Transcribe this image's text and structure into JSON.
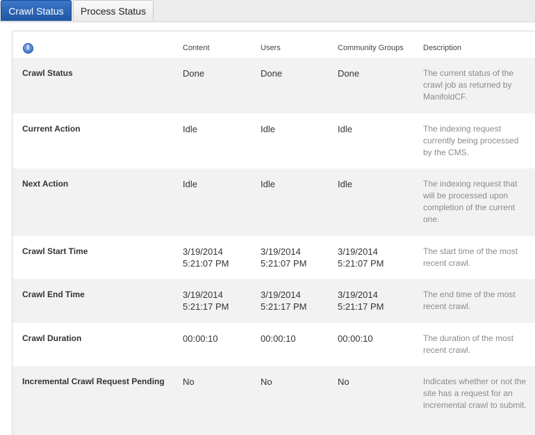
{
  "tabs": {
    "crawl_status": "Crawl Status",
    "process_status": "Process Status"
  },
  "table": {
    "headers": {
      "content": "Content",
      "users": "Users",
      "groups": "Community Groups",
      "description": "Description"
    },
    "rows": [
      {
        "label": "Crawl Status",
        "content": "Done",
        "users": "Done",
        "groups": "Done",
        "description": "The current status of the crawl job as returned by ManifoldCF."
      },
      {
        "label": "Current Action",
        "content": "Idle",
        "users": "Idle",
        "groups": "Idle",
        "description": "The indexing request currently being processed by the CMS."
      },
      {
        "label": "Next Action",
        "content": "Idle",
        "users": "Idle",
        "groups": "Idle",
        "description": "The indexing request that will be processed upon completion of the current one."
      },
      {
        "label": "Crawl Start Time",
        "content": "3/19/2014 5:21:07 PM",
        "users": "3/19/2014 5:21:07 PM",
        "groups": "3/19/2014 5:21:07 PM",
        "description": "The start time of the most recent crawl."
      },
      {
        "label": "Crawl End Time",
        "content": "3/19/2014 5:21:17 PM",
        "users": "3/19/2014 5:21:17 PM",
        "groups": "3/19/2014 5:21:17 PM",
        "description": "The end time of the most recent crawl."
      },
      {
        "label": "Crawl Duration",
        "content": "00:00:10",
        "users": "00:00:10",
        "groups": "00:00:10",
        "description": "The duration of the most recent crawl."
      },
      {
        "label": "Incremental Crawl Request Pending",
        "content": "No",
        "users": "No",
        "groups": "No",
        "description": "Indicates whether or not the site has a request for an incremental crawl to submit."
      }
    ]
  }
}
